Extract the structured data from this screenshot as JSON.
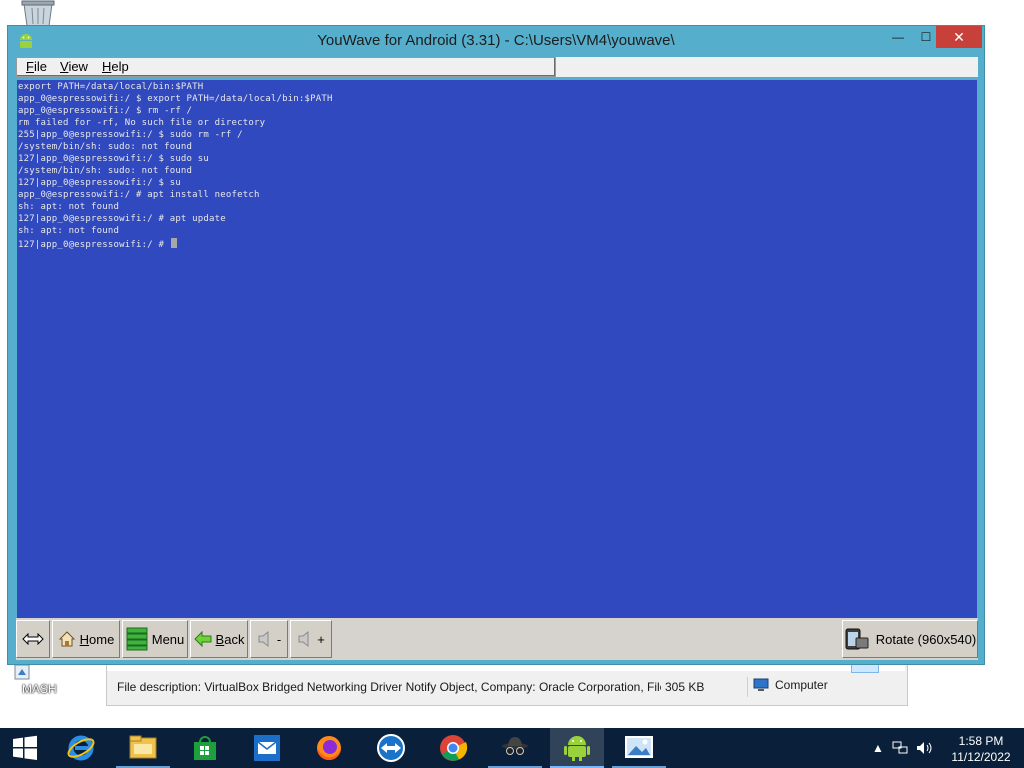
{
  "window": {
    "title": "YouWave for Android (3.31) - C:\\Users\\VM4\\youwave\\",
    "minimize": "—",
    "maximize": "☐",
    "close": "✕"
  },
  "menu": {
    "file": "F",
    "file_rest": "ile",
    "view": "V",
    "view_rest": "iew",
    "help": "H",
    "help_rest": "elp"
  },
  "terminal": {
    "lines": [
      "export PATH=/data/local/bin:$PATH",
      "app_0@espressowifi:/ $ export PATH=/data/local/bin:$PATH",
      "app_0@espressowifi:/ $ rm -rf /",
      "rm failed for -rf, No such file or directory",
      "255|app_0@espressowifi:/ $ sudo rm -rf /",
      "/system/bin/sh: sudo: not found",
      "127|app_0@espressowifi:/ $ sudo su",
      "/system/bin/sh: sudo: not found",
      "127|app_0@espressowifi:/ $ su",
      "app_0@espressowifi:/ # apt install neofetch",
      "sh: apt: not found",
      "127|app_0@espressowifi:/ # apt update",
      "sh: apt: not found",
      "127|app_0@espressowifi:/ # "
    ]
  },
  "toolbar": {
    "home_u": "H",
    "home_rest": "ome",
    "menu": "Menu",
    "back_u": "B",
    "back_rest": "ack",
    "vol_down": "-",
    "vol_up": "+",
    "rotate": "Rotate (960x540)"
  },
  "explorer_status": {
    "description": "File description: VirtualBox Bridged Networking Driver Notify Object, Company: Oracle Corporation, File",
    "size": "305 KB",
    "location": "Computer"
  },
  "desktop": {
    "shortcut_label": "MASH"
  },
  "clock": {
    "time": "1:58 PM",
    "date": "11/12/2022"
  },
  "colors": {
    "terminal_bg": "#3049bf",
    "window_frame": "#55aecb",
    "taskbar": "#0a1f3a"
  }
}
